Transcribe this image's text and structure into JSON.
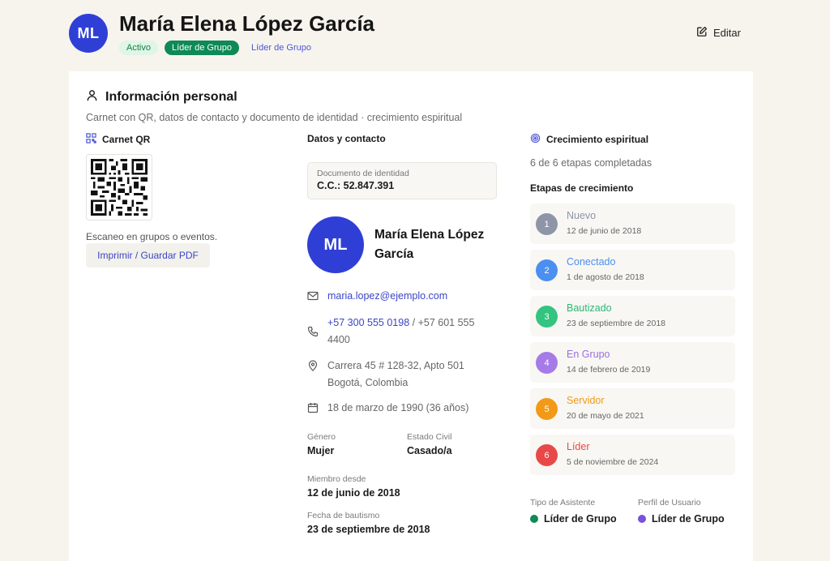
{
  "profile": {
    "initials": "ML",
    "name": "María Elena López García",
    "badges": {
      "status": "Activo",
      "role": "Líder de Grupo",
      "role_link": "Líder de Grupo"
    },
    "edit_label": "Editar"
  },
  "section": {
    "title": "Información personal",
    "subtitle": "Carnet con QR, datos de contacto y documento de identidad · crecimiento espiritual"
  },
  "qr": {
    "heading": "Carnet QR",
    "help_text": "Escaneo en grupos o eventos.",
    "print_label": "Imprimir / Guardar PDF"
  },
  "contact": {
    "heading": "Datos y contacto",
    "document_label": "Documento de identidad",
    "document_value": "C.C.: 52.847.391",
    "initials": "ML",
    "name": "María Elena López García",
    "email": "maria.lopez@ejemplo.com",
    "phone_primary": "+57 300 555 0198",
    "phone_secondary": " / +57 601 555 4400",
    "address": "Carrera 45 # 128-32, Apto 501 Bogotá, Colombia",
    "birthdate": "18 de marzo de 1990 (36 años)",
    "gender_label": "Género",
    "gender_value": "Mujer",
    "civil_label": "Estado Civil",
    "civil_value": "Casado/a",
    "member_label": "Miembro desde",
    "member_value": "12 de junio de 2018",
    "baptism_label": "Fecha de bautismo",
    "baptism_value": "23 de septiembre de 2018"
  },
  "growth": {
    "heading": "Crecimiento espiritual",
    "count_text": "6 de 6 etapas completadas",
    "stages_heading": "Etapas de crecimiento",
    "stages": [
      {
        "num": "1",
        "name": "Nuevo",
        "date": "12 de junio de 2018",
        "color": "#8f95a8",
        "text_color": "#8f95a8"
      },
      {
        "num": "2",
        "name": "Conectado",
        "date": "1 de agosto de 2018",
        "color": "#4b8ff0",
        "text_color": "#4b8ff0"
      },
      {
        "num": "3",
        "name": "Bautizado",
        "date": "23 de septiembre de 2018",
        "color": "#33c480",
        "text_color": "#2eb675"
      },
      {
        "num": "4",
        "name": "En Grupo",
        "date": "14 de febrero de 2019",
        "color": "#a57be8",
        "text_color": "#9a6fe0"
      },
      {
        "num": "5",
        "name": "Servidor",
        "date": "20 de mayo de 2021",
        "color": "#f29a18",
        "text_color": "#f29a18"
      },
      {
        "num": "6",
        "name": "Líder",
        "date": "5 de noviembre de 2024",
        "color": "#e84848",
        "text_color": "#e84848"
      }
    ],
    "assistant_type_label": "Tipo de Asistente",
    "assistant_type_value": "Líder de Grupo",
    "assistant_type_color": "#0d8a55",
    "user_profile_label": "Perfil de Usuario",
    "user_profile_value": "Líder de Grupo",
    "user_profile_color": "#7b4fe0"
  }
}
